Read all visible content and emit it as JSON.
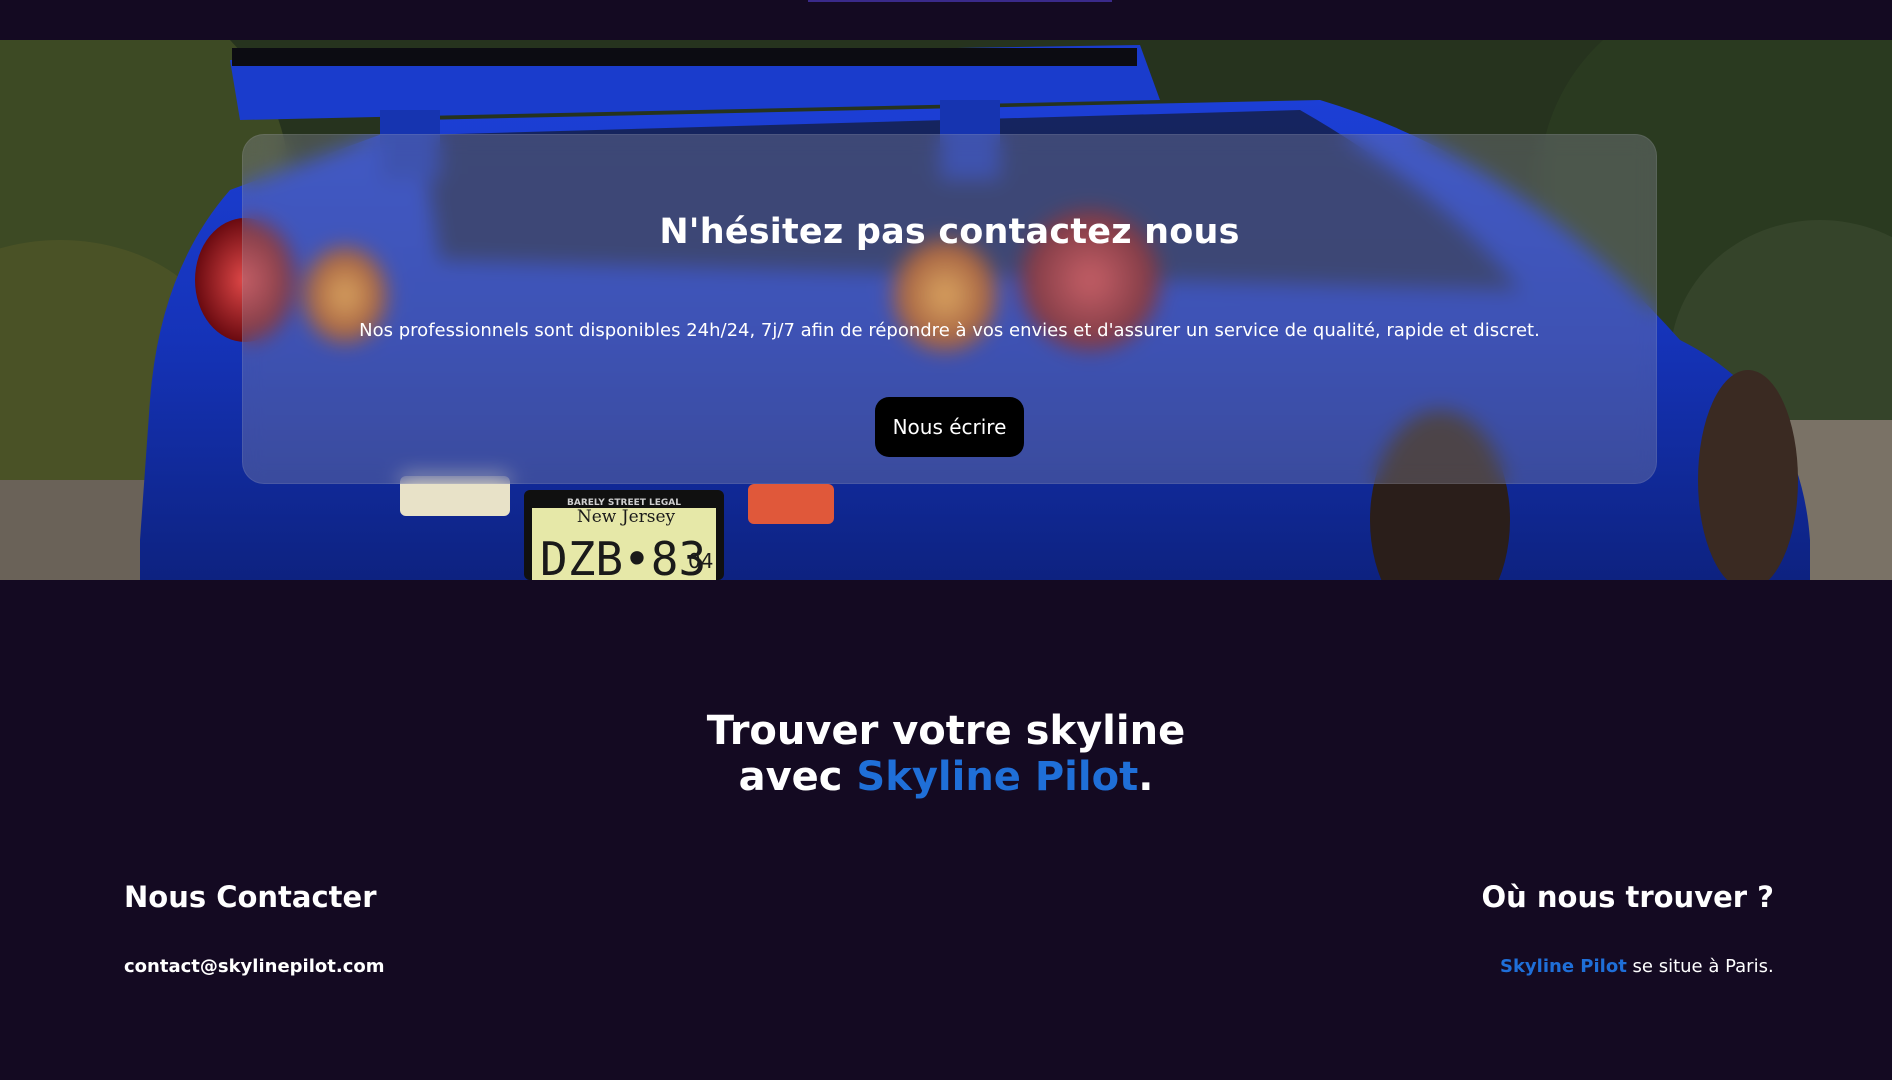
{
  "hero": {
    "title": "N'hésitez pas contactez nous",
    "description": "Nos professionnels sont disponibles 24h/24, 7j/7 afin de répondre à vos envies et d'assurer un service de qualité, rapide et discret.",
    "button_label": "Nous écrire",
    "plate_header": "BARELY STREET LEGAL",
    "plate_state": "New Jersey",
    "plate_number": "DZB•83",
    "plate_suffix": "04"
  },
  "slogan": {
    "line1": "Trouver votre skyline",
    "line2_prefix": "avec ",
    "brand": "Skyline Pilot",
    "line2_suffix": "."
  },
  "contact": {
    "heading": "Nous Contacter",
    "email": "contact@skylinepilot.com"
  },
  "location": {
    "heading": "Où nous trouver ?",
    "brand": "Skyline Pilot",
    "text": " se situe à Paris."
  },
  "colors": {
    "background": "#140a22",
    "brand_blue": "#1f6fd8",
    "button": "#000000"
  }
}
